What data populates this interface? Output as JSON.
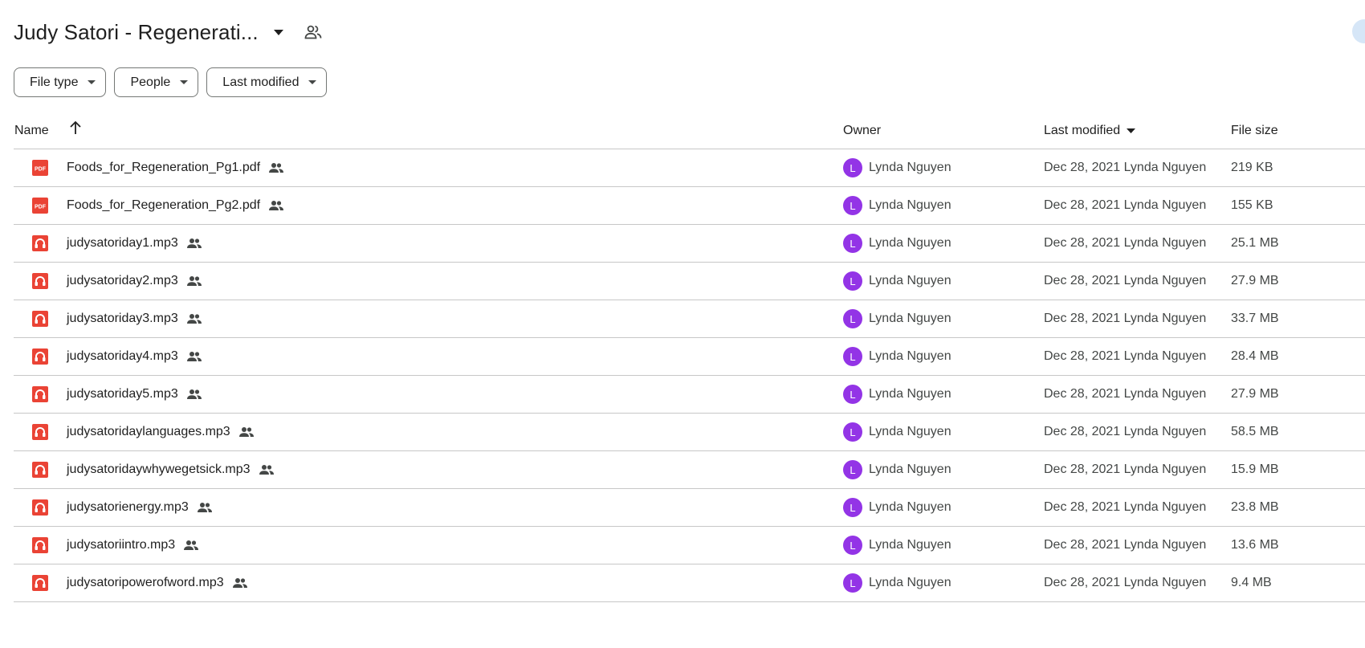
{
  "header": {
    "title": "Judy Satori - Regenerati..."
  },
  "filters": [
    {
      "label": "File type"
    },
    {
      "label": "People"
    },
    {
      "label": "Last modified"
    }
  ],
  "columns": {
    "name": "Name",
    "owner": "Owner",
    "last_modified": "Last modified",
    "file_size": "File size"
  },
  "colors": {
    "file_icon_red": "#ea4335",
    "avatar_purple": "#9334e6"
  },
  "files": [
    {
      "name": "Foods_for_Regeneration_Pg1.pdf",
      "type": "pdf",
      "icon": "pdf-icon",
      "owner_initial": "L",
      "owner": "Lynda Nguyen",
      "modified": "Dec 28, 2021 Lynda Nguyen",
      "size": "219 KB"
    },
    {
      "name": "Foods_for_Regeneration_Pg2.pdf",
      "type": "pdf",
      "icon": "pdf-icon",
      "owner_initial": "L",
      "owner": "Lynda Nguyen",
      "modified": "Dec 28, 2021 Lynda Nguyen",
      "size": "155 KB"
    },
    {
      "name": "judysatoriday1.mp3",
      "type": "audio",
      "icon": "audio-file-icon",
      "owner_initial": "L",
      "owner": "Lynda Nguyen",
      "modified": "Dec 28, 2021 Lynda Nguyen",
      "size": "25.1 MB"
    },
    {
      "name": "judysatoriday2.mp3",
      "type": "audio",
      "icon": "audio-file-icon",
      "owner_initial": "L",
      "owner": "Lynda Nguyen",
      "modified": "Dec 28, 2021 Lynda Nguyen",
      "size": "27.9 MB"
    },
    {
      "name": "judysatoriday3.mp3",
      "type": "audio",
      "icon": "audio-file-icon",
      "owner_initial": "L",
      "owner": "Lynda Nguyen",
      "modified": "Dec 28, 2021 Lynda Nguyen",
      "size": "33.7 MB"
    },
    {
      "name": "judysatoriday4.mp3",
      "type": "audio",
      "icon": "audio-file-icon",
      "owner_initial": "L",
      "owner": "Lynda Nguyen",
      "modified": "Dec 28, 2021 Lynda Nguyen",
      "size": "28.4 MB"
    },
    {
      "name": "judysatoriday5.mp3",
      "type": "audio",
      "icon": "audio-file-icon",
      "owner_initial": "L",
      "owner": "Lynda Nguyen",
      "modified": "Dec 28, 2021 Lynda Nguyen",
      "size": "27.9 MB"
    },
    {
      "name": "judysatoridaylanguages.mp3",
      "type": "audio",
      "icon": "audio-file-icon",
      "owner_initial": "L",
      "owner": "Lynda Nguyen",
      "modified": "Dec 28, 2021 Lynda Nguyen",
      "size": "58.5 MB"
    },
    {
      "name": "judysatoridaywhywegetsick.mp3",
      "type": "audio",
      "icon": "audio-file-icon",
      "owner_initial": "L",
      "owner": "Lynda Nguyen",
      "modified": "Dec 28, 2021 Lynda Nguyen",
      "size": "15.9 MB"
    },
    {
      "name": "judysatorienergy.mp3",
      "type": "audio",
      "icon": "audio-file-icon",
      "owner_initial": "L",
      "owner": "Lynda Nguyen",
      "modified": "Dec 28, 2021 Lynda Nguyen",
      "size": "23.8 MB"
    },
    {
      "name": "judysatoriintro.mp3",
      "type": "audio",
      "icon": "audio-file-icon",
      "owner_initial": "L",
      "owner": "Lynda Nguyen",
      "modified": "Dec 28, 2021 Lynda Nguyen",
      "size": "13.6 MB"
    },
    {
      "name": "judysatoripowerofword.mp3",
      "type": "audio",
      "icon": "audio-file-icon",
      "owner_initial": "L",
      "owner": "Lynda Nguyen",
      "modified": "Dec 28, 2021 Lynda Nguyen",
      "size": "9.4 MB"
    }
  ]
}
